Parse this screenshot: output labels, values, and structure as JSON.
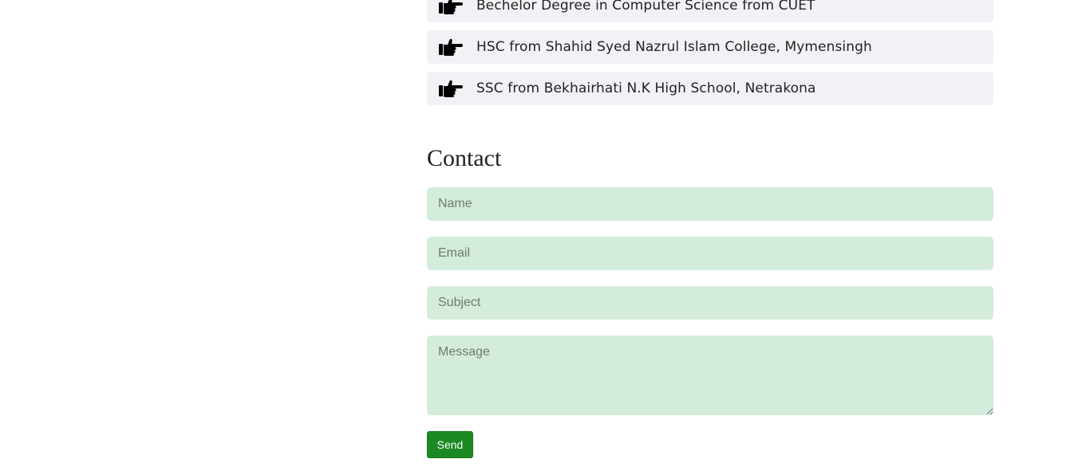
{
  "education": {
    "items": [
      {
        "icon": "pointing-hand-icon",
        "text": "Bechelor Degree in Computer Science from CUET"
      },
      {
        "icon": "pointing-hand-icon",
        "text": "HSC from Shahid Syed Nazrul Islam College, Mymensingh"
      },
      {
        "icon": "pointing-hand-icon",
        "text": "SSC from Bekhairhati N.K High School, Netrakona"
      }
    ]
  },
  "contact": {
    "title": "Contact",
    "name_placeholder": "Name",
    "email_placeholder": "Email",
    "subject_placeholder": "Subject",
    "message_placeholder": "Message",
    "send_label": "Send"
  },
  "colors": {
    "field_bg": "#d4ecdb",
    "item_bg": "#f1f2f5",
    "button_bg": "#1c8a24"
  }
}
